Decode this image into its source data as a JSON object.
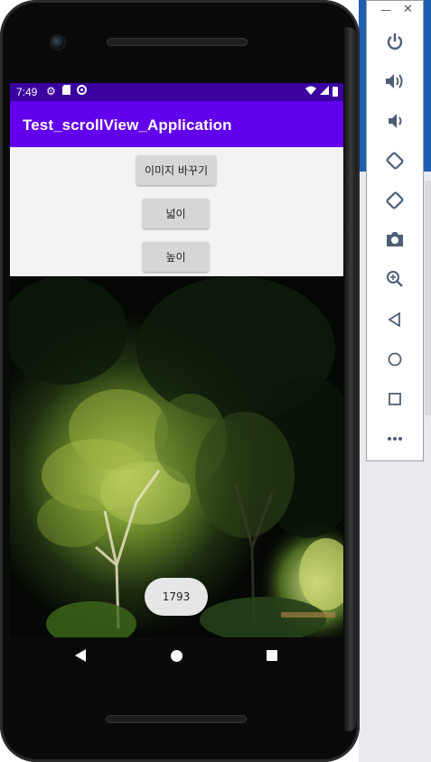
{
  "status_bar": {
    "time": "7:49",
    "left_icons": [
      "gear-icon",
      "sd-card-icon",
      "sync-icon"
    ],
    "right_icons": [
      "wifi-icon",
      "signal-icon",
      "battery-icon"
    ]
  },
  "app_bar": {
    "title": "Test_scrollView_Application"
  },
  "buttons": {
    "change_image": "이미지 바꾸기",
    "width": "넓이",
    "height": "높이"
  },
  "toast": {
    "text": "1793"
  },
  "nav_bar": {
    "icons": [
      "back-icon",
      "home-icon",
      "recents-icon"
    ]
  },
  "emulator_toolbar": {
    "window_controls": [
      "minimize-icon",
      "close-icon"
    ],
    "items": [
      "power-icon",
      "volume-up-icon",
      "volume-down-icon",
      "rotate-left-icon",
      "rotate-right-icon",
      "screenshot-icon",
      "zoom-icon",
      "back-icon",
      "home-icon",
      "overview-icon",
      "more-icon"
    ]
  },
  "colors": {
    "status_bar": "#3a00a0",
    "app_bar": "#6200ee",
    "button": "#d6d6d6",
    "content_bg": "#f3f3f3"
  }
}
